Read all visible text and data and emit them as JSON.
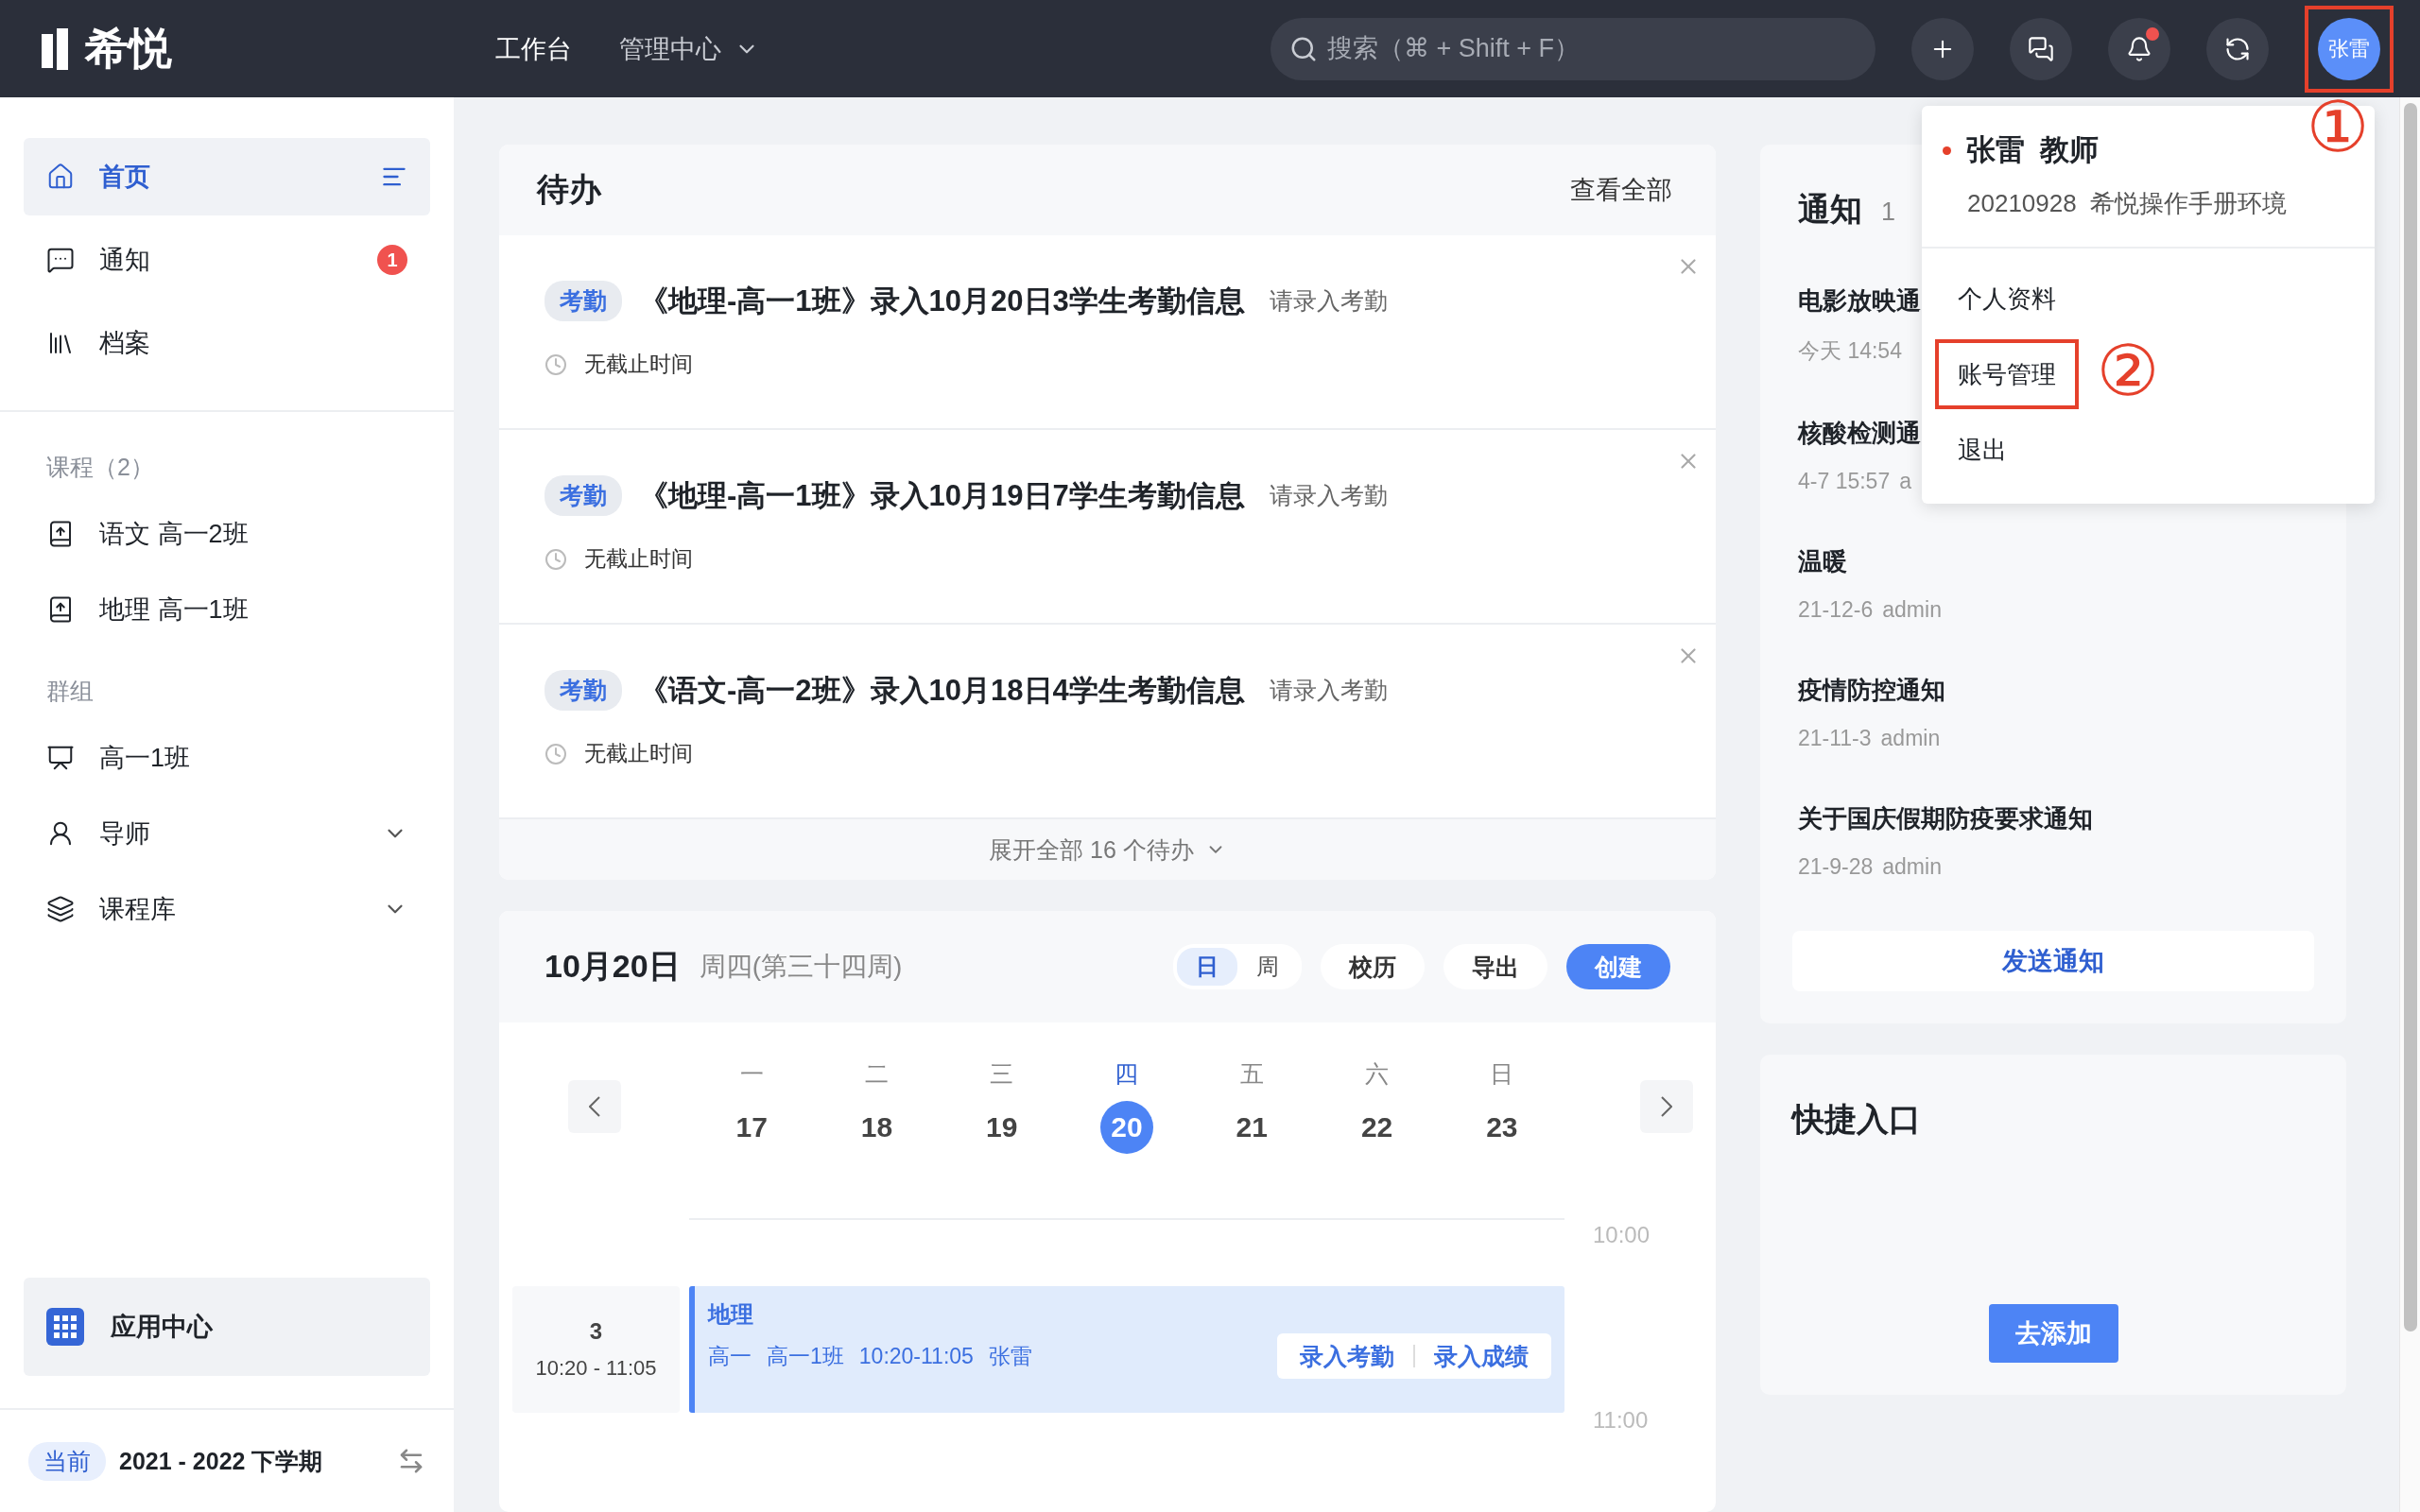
{
  "topbar": {
    "logo": "希悦",
    "nav": [
      {
        "label": "工作台",
        "kind": "link",
        "selected": true
      },
      {
        "label": "管理中心",
        "kind": "menu",
        "selected": false
      }
    ],
    "search": {
      "placeholder": "搜索（⌘ + Shift + F）"
    },
    "actions": [
      {
        "kind": "add",
        "dot": false
      },
      {
        "kind": "messages",
        "dot": false
      },
      {
        "kind": "bell",
        "dot": true
      },
      {
        "kind": "switch",
        "dot": false
      }
    ],
    "user": {
      "avatar": "张雷",
      "highlighted": true
    }
  },
  "sidebar": {
    "items": [
      {
        "label": "首页",
        "selected": true
      },
      {
        "label": "通知",
        "selected": false,
        "badge": "1"
      },
      {
        "label": "档案",
        "selected": false
      }
    ],
    "sections": [
      {
        "title": "课程（2）",
        "items": [
          {
            "label": "语文 高一2班",
            "expandable": false
          },
          {
            "label": "地理 高一1班",
            "expandable": false
          }
        ]
      },
      {
        "title": "群组",
        "items": [
          {
            "label": "高一1班",
            "expandable": false
          },
          {
            "label": "导师",
            "expandable": true
          },
          {
            "label": "课程库",
            "expandable": true
          }
        ]
      }
    ],
    "app_center": "应用中心",
    "term": {
      "tag": "当前",
      "label": "2021 - 2022 下学期"
    }
  },
  "todo": {
    "title": "待办",
    "link": "查看全部",
    "items": [
      {
        "tag": "考勤",
        "title": "《地理-高一1班》录入10月20日3学生考勤信息",
        "action": "请录入考勤",
        "deadline": "无截止时间"
      },
      {
        "tag": "考勤",
        "title": "《地理-高一1班》录入10月19日7学生考勤信息",
        "action": "请录入考勤",
        "deadline": "无截止时间"
      },
      {
        "tag": "考勤",
        "title": "《语文-高一2班》录入10月18日4学生考勤信息",
        "action": "请录入考勤",
        "deadline": "无截止时间"
      }
    ],
    "footer": "展开全部 16 个待办"
  },
  "calendar": {
    "date": "10月20日",
    "weekday": "周四(第三十四周)",
    "views": [
      {
        "label": "日",
        "selected": true
      },
      {
        "label": "周",
        "selected": false
      }
    ],
    "buttons": [
      {
        "label": "校历",
        "kind": "plain"
      },
      {
        "label": "导出",
        "kind": "plain"
      },
      {
        "label": "创建",
        "kind": "primary"
      }
    ],
    "days": [
      {
        "weekday": "一",
        "date": "17",
        "selected": false
      },
      {
        "weekday": "二",
        "date": "18",
        "selected": false
      },
      {
        "weekday": "三",
        "date": "19",
        "selected": false
      },
      {
        "weekday": "四",
        "date": "20",
        "selected": true
      },
      {
        "weekday": "五",
        "date": "21",
        "selected": false
      },
      {
        "weekday": "六",
        "date": "22",
        "selected": false
      },
      {
        "weekday": "日",
        "date": "23",
        "selected": false
      }
    ],
    "times": [
      "10:00",
      "11:00"
    ],
    "lesson": {
      "period": "3",
      "time": "10:20 - 11:05",
      "subject": "地理",
      "details": [
        "高一",
        "高一1班",
        "10:20-11:05",
        "张雷"
      ],
      "actions": [
        "录入考勤",
        "录入成绩"
      ]
    }
  },
  "notices": {
    "title": "通知",
    "count": "1",
    "items": [
      {
        "title": "电影放映通",
        "date": "今天 14:54"
      },
      {
        "title": "核酸检测通",
        "date": "4-7 15:57",
        "author": "a"
      },
      {
        "title": "温暖",
        "date": "21-12-6",
        "author": "admin"
      },
      {
        "title": "疫情防控通知",
        "date": "21-11-3",
        "author": "admin"
      },
      {
        "title": "关于国庆假期防疫要求通知",
        "date": "21-9-28",
        "author": "admin"
      }
    ],
    "button": "发送通知"
  },
  "quick": {
    "title": "快捷入口",
    "button": "去添加"
  },
  "user_menu": {
    "name": "张雷",
    "role": "教师",
    "id": "20210928",
    "env": "希悦操作手册环境",
    "items": [
      {
        "label": "个人资料",
        "highlighted": false
      },
      {
        "label": "账号管理",
        "highlighted": true
      },
      {
        "label": "退出",
        "highlighted": false
      }
    ]
  },
  "annotations": [
    "①",
    "②"
  ]
}
